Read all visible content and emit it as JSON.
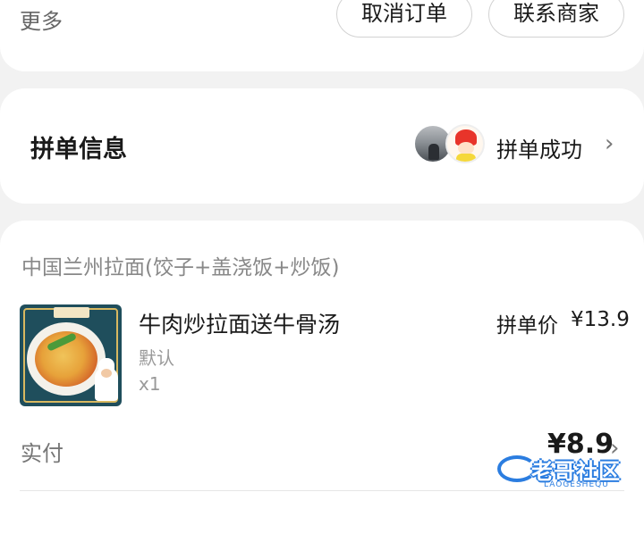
{
  "actions": {
    "more_label": "更多",
    "cancel_label": "取消订单",
    "contact_label": "联系商家"
  },
  "group": {
    "title": "拼单信息",
    "status": "拼单成功",
    "chevron": "›"
  },
  "order": {
    "shop_name": "中国兰州拉面(饺子+盖浇饭+炒饭)",
    "item": {
      "name": "牛肉炒拉面送牛骨汤",
      "spec": "默认",
      "qty": "x1",
      "price_label": "拼单价",
      "price": "¥13.9"
    },
    "paid_label": "实付",
    "paid_amount": "¥8.9",
    "chevron": "›"
  },
  "watermark": {
    "title": "老哥社区",
    "sub": "LAOGESHEQU"
  },
  "colors": {
    "background": "#f2f2f2",
    "card": "#ffffff",
    "text_primary": "#1a1a1a",
    "text_secondary": "#888888",
    "watermark_blue": "#2b7de0"
  },
  "icons": [
    "chevron-right-icon",
    "avatar-icon",
    "dish-photo",
    "site-watermark-logo"
  ]
}
